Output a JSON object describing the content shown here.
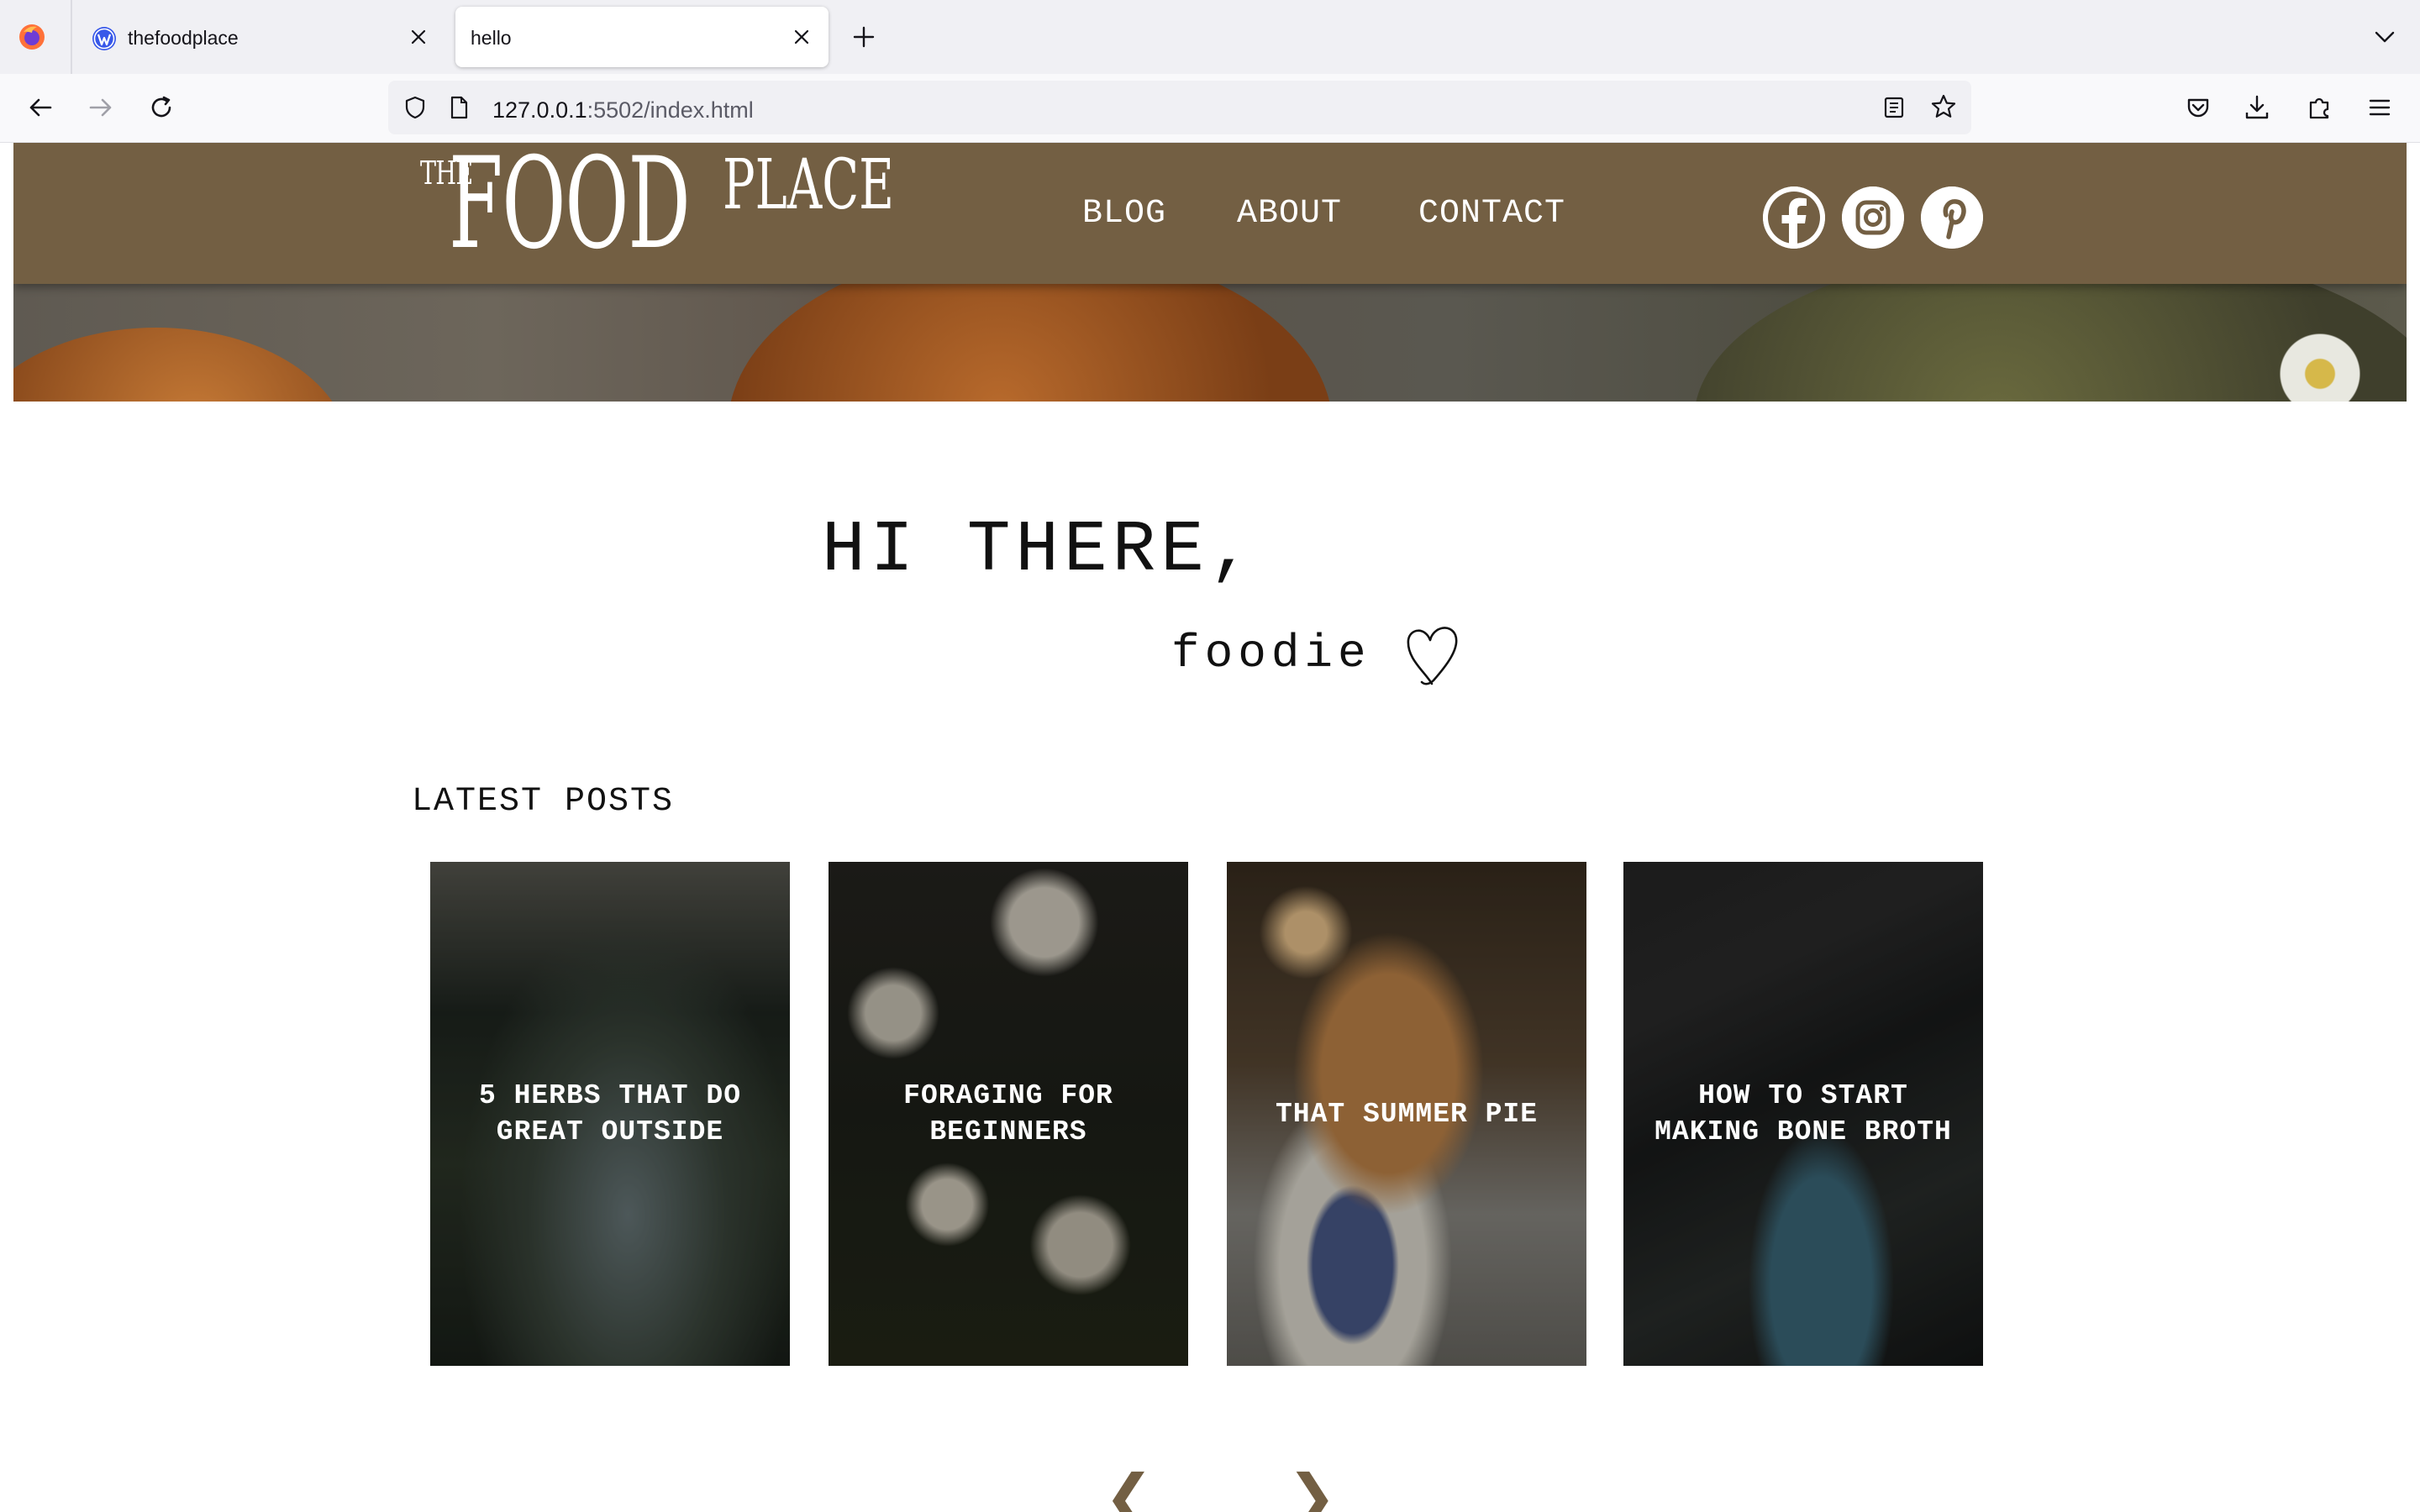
{
  "browser": {
    "tabs": [
      {
        "title": "thefoodplace",
        "icon": "wordpress-icon",
        "active": false
      },
      {
        "title": "hello",
        "active": true
      }
    ],
    "url": {
      "host": "127.0.0.1",
      "rest": ":5502/index.html"
    }
  },
  "site": {
    "logo": {
      "the": "THE",
      "food": "FOOD",
      "place": "PLACE"
    },
    "nav": [
      "BLOG",
      "ABOUT",
      "CONTACT"
    ],
    "social": [
      "facebook-icon",
      "instagram-icon",
      "pinterest-icon"
    ],
    "greeting": "HI THERE,",
    "subgreeting": "foodie",
    "latest_heading": "LATEST POSTS",
    "posts": [
      {
        "title": "5 HERBS THAT DO GREAT OUTSIDE"
      },
      {
        "title": "FORAGING FOR BEGINNERS"
      },
      {
        "title": "THAT SUMMER PIE"
      },
      {
        "title": "HOW TO START MAKING BONE BROTH"
      }
    ],
    "pager": {
      "prev": "❮",
      "next": "❯"
    },
    "colors": {
      "header": "#735f43",
      "accent": "#735f43",
      "text": "#111111"
    }
  }
}
